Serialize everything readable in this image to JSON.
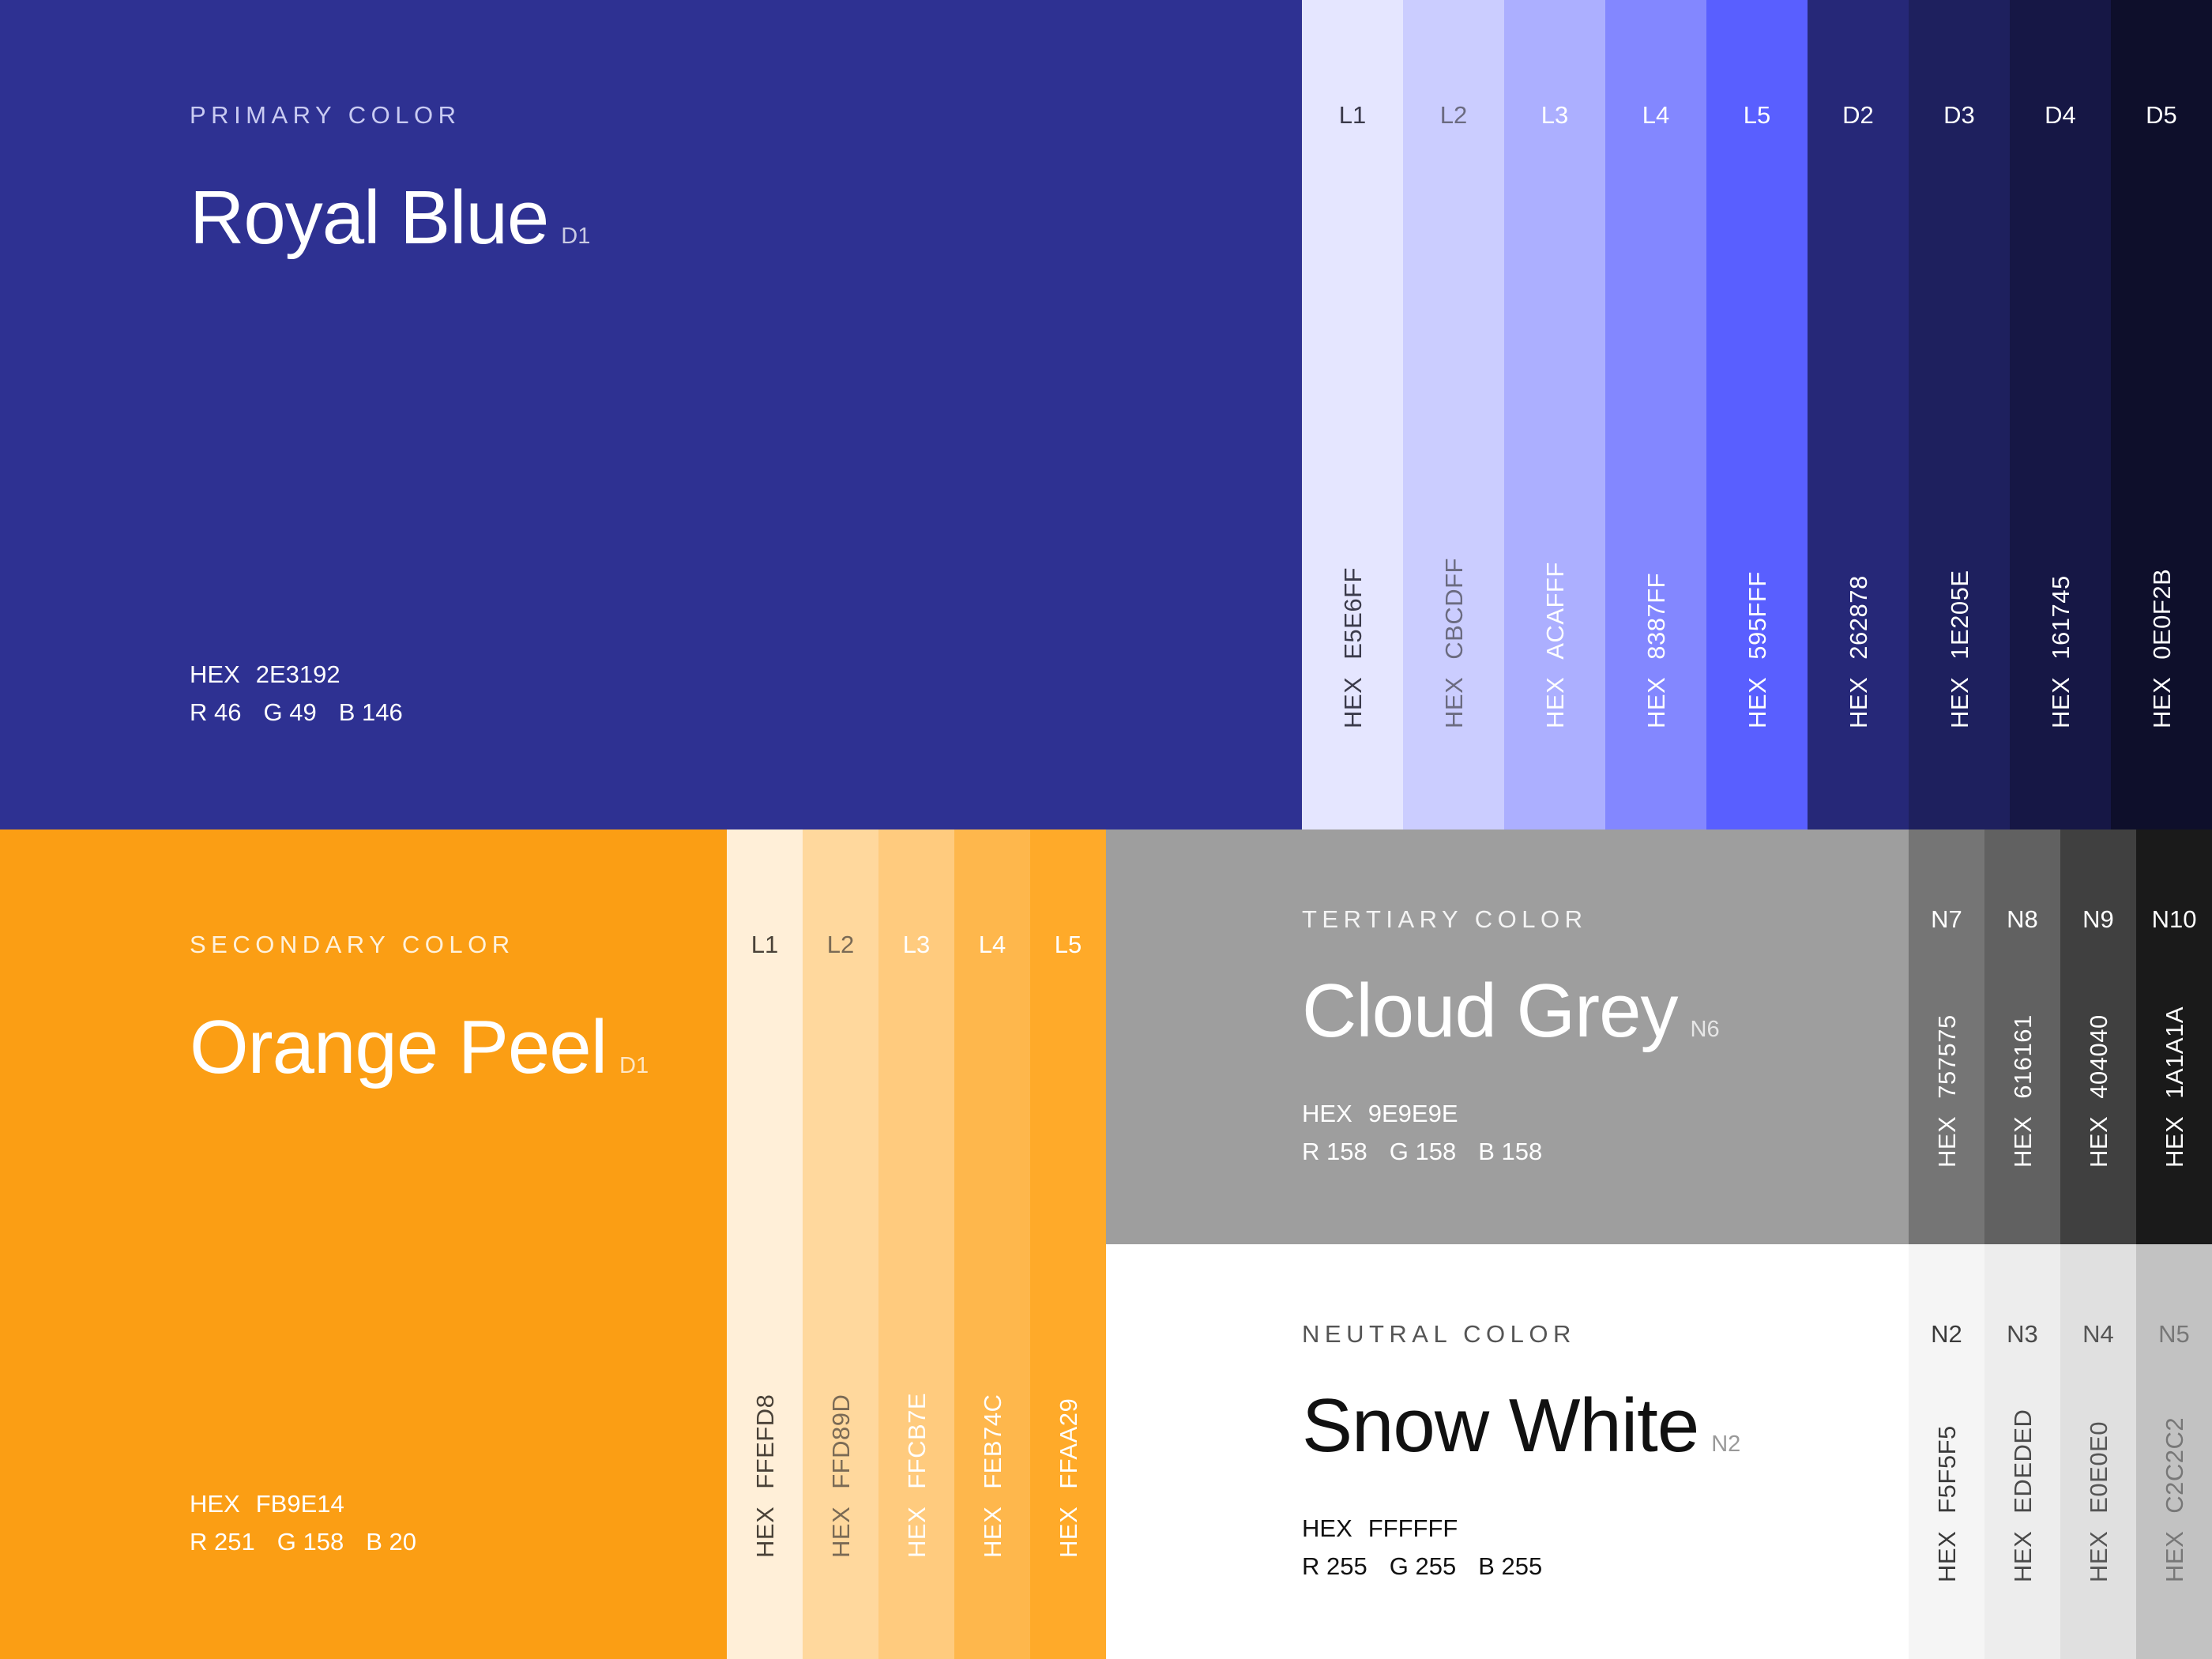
{
  "primary": {
    "eyebrow": "PRIMARY COLOR",
    "name": "Royal Blue",
    "tag": "D1",
    "hex_label": "HEX",
    "hex": "2E3192",
    "r": "R 46",
    "g": "G 49",
    "b": "B 146",
    "color": "#2E3192",
    "shades": [
      {
        "label": "L1",
        "hex": "E5E6FF",
        "color": "#E5E6FF",
        "text": "#3a3a4a"
      },
      {
        "label": "L2",
        "hex": "CBCDFF",
        "color": "#CBCDFF",
        "text": "#6b6b80"
      },
      {
        "label": "L3",
        "hex": "ACAFFF",
        "color": "#ACAFFF",
        "text": "#ffffff"
      },
      {
        "label": "L4",
        "hex": "8387FF",
        "color": "#8387FF",
        "text": "#ffffff"
      },
      {
        "label": "L5",
        "hex": "595FFF",
        "color": "#595FFF",
        "text": "#ffffff"
      },
      {
        "label": "D2",
        "hex": "262878",
        "color": "#262878",
        "text": "#ffffff"
      },
      {
        "label": "D3",
        "hex": "1E205E",
        "color": "#1E205E",
        "text": "#ffffff"
      },
      {
        "label": "D4",
        "hex": "161745",
        "color": "#161745",
        "text": "#ffffff"
      },
      {
        "label": "D5",
        "hex": "0E0F2B",
        "color": "#0E0F2B",
        "text": "#ffffff"
      }
    ]
  },
  "secondary": {
    "eyebrow": "SECONDARY COLOR",
    "name": "Orange Peel",
    "tag": "D1",
    "hex_label": "HEX",
    "hex": "FB9E14",
    "r": "R 251",
    "g": "G 158",
    "b": "B 20",
    "color": "#FB9E14",
    "shades": [
      {
        "label": "L1",
        "hex": "FFEFD8",
        "color": "#FFEFD8",
        "text": "#4a4238"
      },
      {
        "label": "L2",
        "hex": "FFD89D",
        "color": "#FFD89D",
        "text": "#7a6a55"
      },
      {
        "label": "L3",
        "hex": "FFCB7E",
        "color": "#FFCB7E",
        "text": "#ffffff"
      },
      {
        "label": "L4",
        "hex": "FEB74C",
        "color": "#FEB74C",
        "text": "#ffffff"
      },
      {
        "label": "L5",
        "hex": "FFAA29",
        "color": "#FFAA29",
        "text": "#ffffff"
      }
    ]
  },
  "tertiary": {
    "eyebrow": "TERTIARY COLOR",
    "name": "Cloud Grey",
    "tag": "N6",
    "hex_label": "HEX",
    "hex": "9E9E9E",
    "r": "R 158",
    "g": "G 158",
    "b": "B 158",
    "color": "#9E9E9E",
    "shades": [
      {
        "label": "N7",
        "hex": "757575",
        "color": "#757575",
        "text": "#ffffff"
      },
      {
        "label": "N8",
        "hex": "616161",
        "color": "#616161",
        "text": "#ffffff"
      },
      {
        "label": "N9",
        "hex": "404040",
        "color": "#404040",
        "text": "#ffffff"
      },
      {
        "label": "N10",
        "hex": "1A1A1A",
        "color": "#1A1A1A",
        "text": "#ffffff"
      }
    ]
  },
  "neutral": {
    "eyebrow": "NEUTRAL COLOR",
    "name": "Snow White",
    "tag": "N2",
    "hex_label": "HEX",
    "hex": "FFFFFF",
    "r": "R 255",
    "g": "G 255",
    "b": "B 255",
    "color": "#FFFFFF",
    "shades": [
      {
        "label": "N2",
        "hex": "F5F5F5",
        "color": "#F5F5F5",
        "text": "#3a3a3a"
      },
      {
        "label": "N3",
        "hex": "EDEDED",
        "color": "#EDEDED",
        "text": "#4a4a4a"
      },
      {
        "label": "N4",
        "hex": "E0E0E0",
        "color": "#E0E0E0",
        "text": "#555555"
      },
      {
        "label": "N5",
        "hex": "C2C2C2",
        "color": "#C2C2C2",
        "text": "#777777"
      }
    ]
  }
}
